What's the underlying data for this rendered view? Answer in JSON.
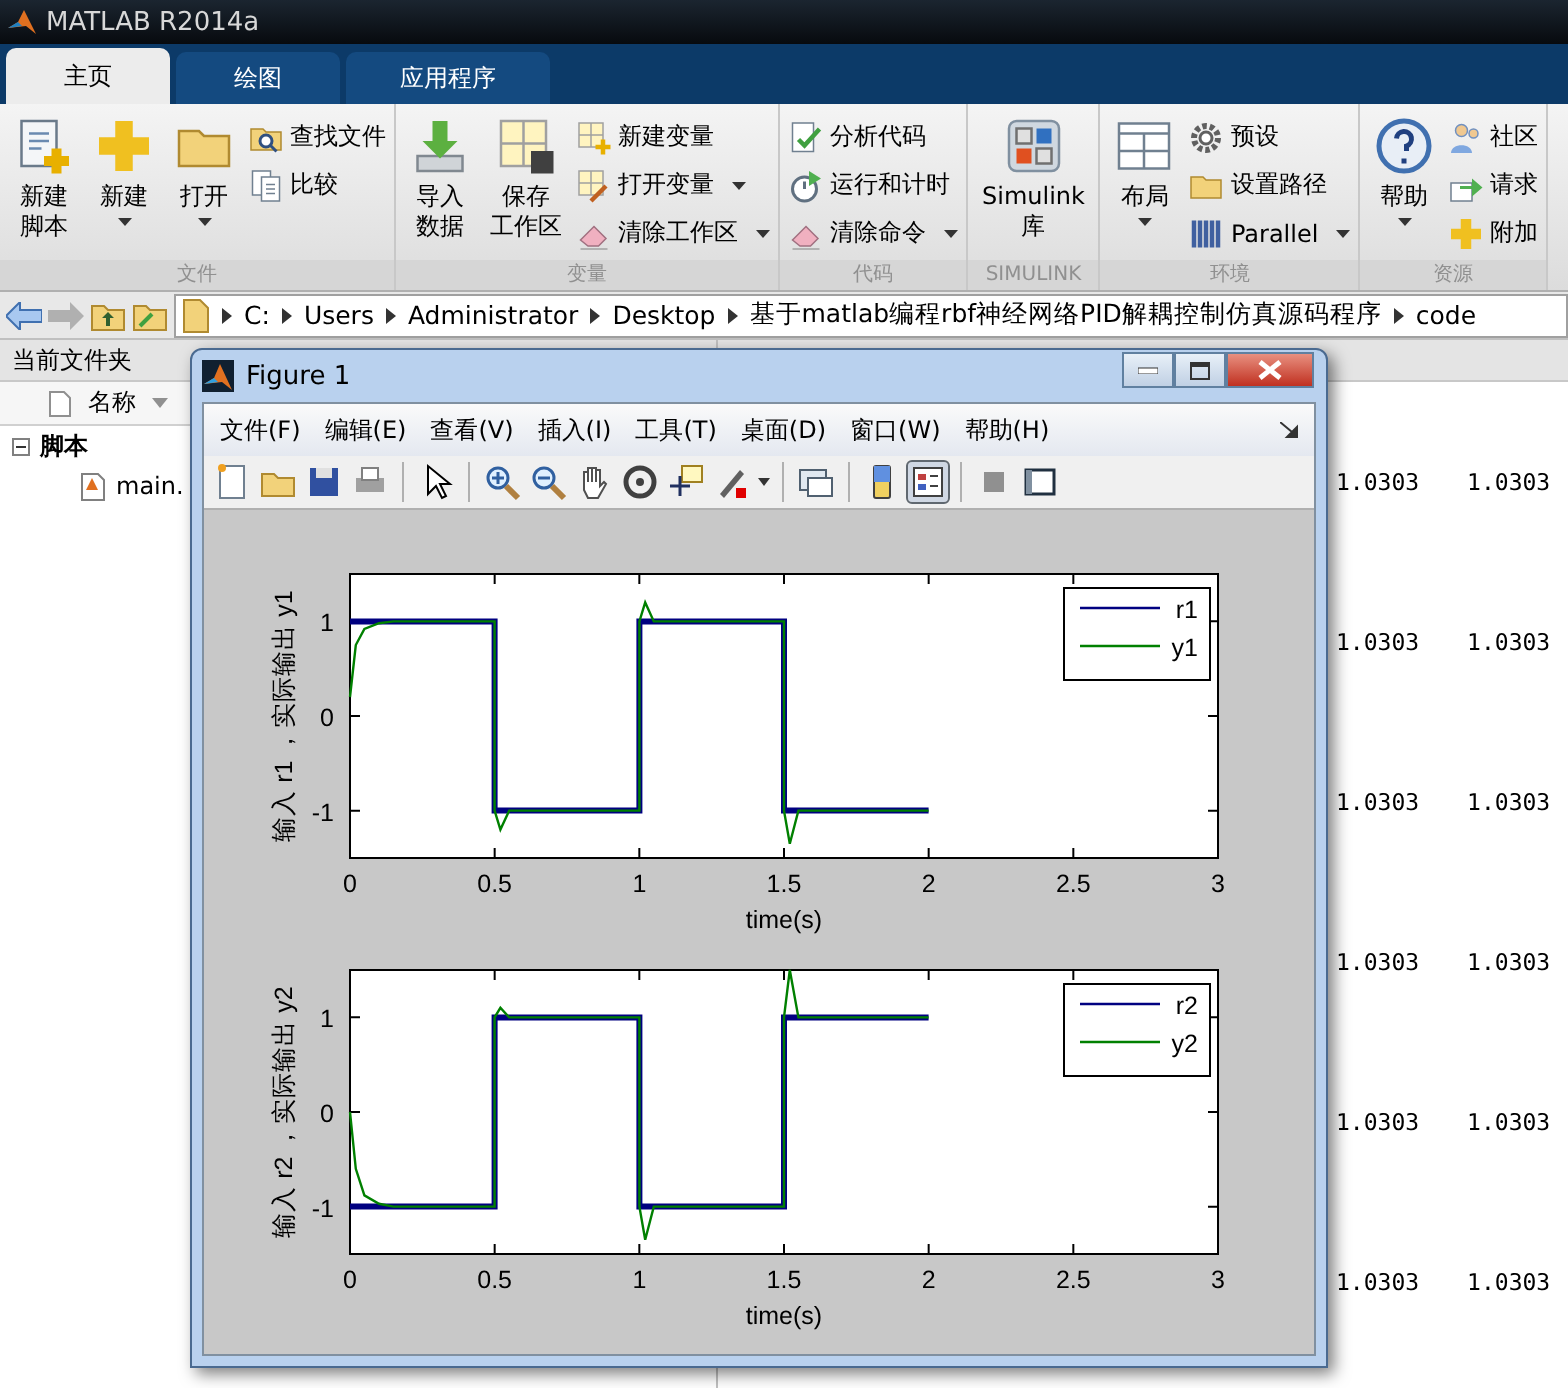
{
  "window": {
    "title": "MATLAB R2014a"
  },
  "tabs": [
    {
      "label": "主页",
      "selected": true
    },
    {
      "label": "绘图",
      "selected": false
    },
    {
      "label": "应用程序",
      "selected": false
    }
  ],
  "ribbon": {
    "groups": [
      {
        "label": "文件",
        "items": [
          {
            "kind": "large",
            "lines": [
              "新建",
              "脚本"
            ],
            "dropdown": false
          },
          {
            "kind": "large",
            "lines": [
              "新建"
            ],
            "dropdown": true
          },
          {
            "kind": "large",
            "lines": [
              "打开"
            ],
            "dropdown": true
          },
          {
            "kind": "stack",
            "items": [
              {
                "label": "查找文件",
                "dropdown": false
              },
              {
                "label": "比较",
                "dropdown": false
              }
            ]
          }
        ]
      },
      {
        "label": "变量",
        "items": [
          {
            "kind": "large",
            "lines": [
              "导入",
              "数据"
            ],
            "dropdown": false
          },
          {
            "kind": "large",
            "lines": [
              "保存",
              "工作区"
            ],
            "dropdown": false
          },
          {
            "kind": "stack",
            "items": [
              {
                "label": "新建变量",
                "dropdown": false
              },
              {
                "label": "打开变量",
                "dropdown": true
              },
              {
                "label": "清除工作区",
                "dropdown": true
              }
            ]
          }
        ]
      },
      {
        "label": "代码",
        "items": [
          {
            "kind": "stack",
            "items": [
              {
                "label": "分析代码",
                "dropdown": false
              },
              {
                "label": "运行和计时",
                "dropdown": false
              },
              {
                "label": "清除命令",
                "dropdown": true
              }
            ]
          }
        ]
      },
      {
        "label": "SIMULINK",
        "items": [
          {
            "kind": "large",
            "lines": [
              "Simulink",
              "库"
            ],
            "dropdown": false
          }
        ]
      },
      {
        "label": "环境",
        "items": [
          {
            "kind": "large",
            "lines": [
              "布局"
            ],
            "dropdown": true
          },
          {
            "kind": "stack",
            "items": [
              {
                "label": "预设",
                "dropdown": false
              },
              {
                "label": "设置路径",
                "dropdown": false
              },
              {
                "label": "Parallel",
                "dropdown": true
              }
            ]
          }
        ]
      },
      {
        "label": "资源",
        "items": [
          {
            "kind": "large",
            "lines": [
              "帮助"
            ],
            "dropdown": true
          },
          {
            "kind": "stack",
            "items": [
              {
                "label": "社区",
                "dropdown": false
              },
              {
                "label": "请求",
                "dropdown": false
              },
              {
                "label": "附加",
                "dropdown": false
              }
            ]
          }
        ]
      }
    ]
  },
  "address_bar": {
    "path": [
      "C:",
      "Users",
      "Administrator",
      "Desktop",
      "基于matlab编程rbf神经网络PID解耦控制仿真源码程序",
      "code"
    ]
  },
  "current_folder": {
    "title": "当前文件夹",
    "column": "名称",
    "tree": [
      {
        "label": "脚本",
        "expanded": true,
        "children": [
          {
            "label": "main."
          }
        ]
      }
    ]
  },
  "command_window": {
    "rows": [
      [
        "1.0303",
        "1.0303"
      ],
      [
        "1.0303",
        "1.0303"
      ],
      [
        "1.0303",
        "1.0303"
      ],
      [
        "1.0303",
        "1.0303"
      ],
      [
        "1.0303",
        "1.0303"
      ],
      [
        "1.0303",
        "1.0303"
      ]
    ]
  },
  "figure": {
    "title": "Figure 1",
    "menu": [
      "文件(F)",
      "编辑(E)",
      "查看(V)",
      "插入(I)",
      "工具(T)",
      "桌面(D)",
      "窗口(W)",
      "帮助(H)"
    ],
    "legend_button_pressed": true,
    "axes": [
      {
        "chart_data": {
          "type": "line",
          "legend": true,
          "xlabel": "time(s)",
          "ylabel": "输入 r1 ，实际输出 y1",
          "x": [
            0,
            0.02,
            0.05,
            0.1,
            0.15,
            0.5,
            0.5,
            0.52,
            0.55,
            1,
            1,
            1.02,
            1.05,
            1.5,
            1.5,
            1.52,
            1.55,
            2
          ],
          "xlim": [
            0,
            3
          ],
          "ylim": [
            -1.5,
            1.5
          ],
          "xticks": [
            0,
            0.5,
            1,
            1.5,
            2,
            2.5,
            3
          ],
          "yticks": [
            -1,
            0,
            1
          ],
          "series": [
            {
              "name": "r1",
              "color": "#000080",
              "values": [
                1,
                1,
                1,
                1,
                1,
                1,
                -1,
                -1,
                -1,
                -1,
                1,
                1,
                1,
                1,
                -1,
                -1,
                -1,
                -1
              ]
            },
            {
              "name": "y1",
              "color": "#008000",
              "values": [
                0.2,
                0.75,
                0.92,
                0.98,
                1,
                1,
                -1,
                -1.2,
                -1,
                -1,
                1,
                1.2,
                1,
                1,
                -1,
                -1.35,
                -1,
                -1
              ]
            }
          ]
        }
      },
      {
        "chart_data": {
          "type": "line",
          "legend": true,
          "xlabel": "time(s)",
          "ylabel": "输入 r2 ，实际输出 y2",
          "x": [
            0,
            0.02,
            0.05,
            0.1,
            0.15,
            0.5,
            0.5,
            0.52,
            0.55,
            1,
            1,
            1.02,
            1.05,
            1.5,
            1.5,
            1.52,
            1.55,
            2
          ],
          "xlim": [
            0,
            3
          ],
          "ylim": [
            -1.5,
            1.5
          ],
          "xticks": [
            0,
            0.5,
            1,
            1.5,
            2,
            2.5,
            3
          ],
          "yticks": [
            -1,
            0,
            1
          ],
          "series": [
            {
              "name": "r2",
              "color": "#000080",
              "values": [
                -1,
                -1,
                -1,
                -1,
                -1,
                -1,
                1,
                1,
                1,
                1,
                -1,
                -1,
                -1,
                -1,
                1,
                1,
                1,
                1
              ]
            },
            {
              "name": "y2",
              "color": "#008000",
              "values": [
                0,
                -0.6,
                -0.88,
                -0.97,
                -1,
                -1,
                1,
                1.1,
                1,
                1,
                -1,
                -1.35,
                -1,
                -1,
                1,
                1.5,
                1,
                1
              ]
            }
          ]
        }
      }
    ]
  }
}
